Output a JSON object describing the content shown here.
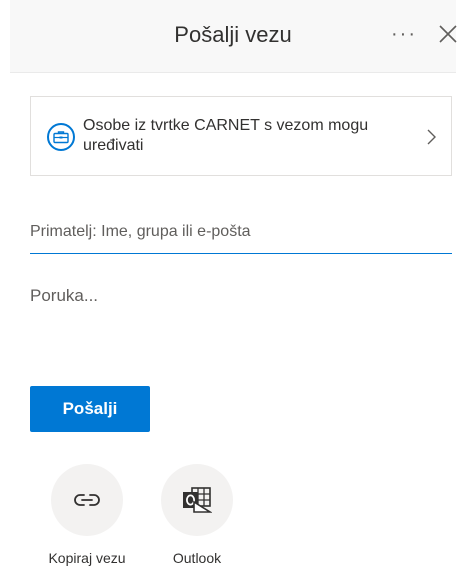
{
  "header": {
    "title": "Pošalji vezu",
    "more_icon": "more-horizontal-icon",
    "close_icon": "close-icon"
  },
  "permission": {
    "text": "Osobe iz tvrtke CARNET s vezom mogu uređivati",
    "icon": "briefcase-icon",
    "chevron_icon": "chevron-right-icon"
  },
  "recipient": {
    "placeholder": "Primatelj: Ime, grupa ili e-pošta",
    "value": ""
  },
  "message": {
    "placeholder": "Poruka...",
    "value": ""
  },
  "send_button": {
    "label": "Pošalji"
  },
  "share_options": [
    {
      "label": "Kopiraj vezu",
      "icon": "link-icon"
    },
    {
      "label": "Outlook",
      "icon": "outlook-icon"
    }
  ],
  "colors": {
    "accent": "#0078d4",
    "header_bg": "#f8f8f8",
    "circle_bg": "#f3f2f1"
  }
}
